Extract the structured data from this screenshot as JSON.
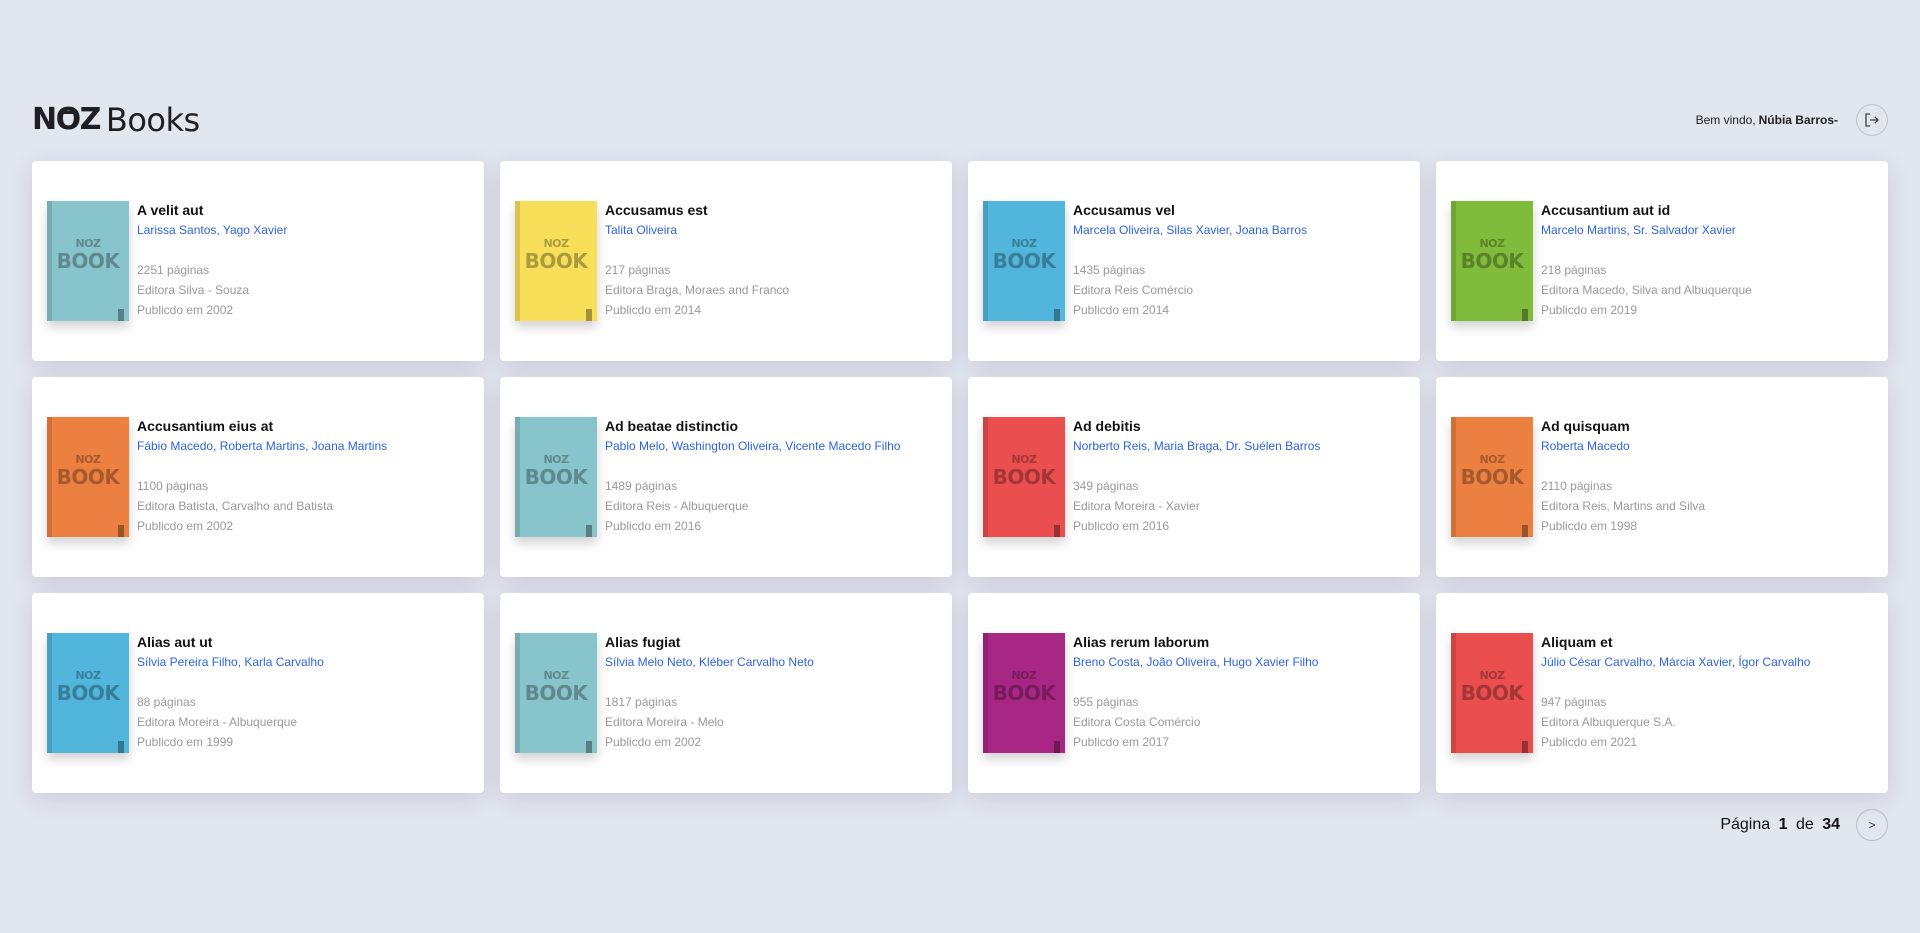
{
  "header": {
    "logo_mark": "NOZ",
    "logo_text": "Books",
    "greeting": "Bem vindo,",
    "user_name": "Núbia Barros-"
  },
  "books": [
    {
      "title": "A velit aut",
      "authors": "Larissa Santos, Yago Xavier",
      "pages": "2251 páginas",
      "publisher": "Editora Silva - Souza",
      "published": "Publicdo em 2002",
      "cover_color": "#88c4cb"
    },
    {
      "title": "Accusamus est",
      "authors": "Talita Oliveira",
      "pages": "217 páginas",
      "publisher": "Editora Braga, Moraes and Franco",
      "published": "Publicdo em 2014",
      "cover_color": "#f7df5a"
    },
    {
      "title": "Accusamus vel",
      "authors": "Marcela Oliveira, Silas Xavier, Joana Barros",
      "pages": "1435 páginas",
      "publisher": "Editora Reis Comércio",
      "published": "Publicdo em 2014",
      "cover_color": "#52b5dc"
    },
    {
      "title": "Accusantium aut id",
      "authors": "Marcelo Martins, Sr. Salvador Xavier",
      "pages": "218 páginas",
      "publisher": "Editora Macedo, Silva and Albuquerque",
      "published": "Publicdo em 2019",
      "cover_color": "#80bb3c"
    },
    {
      "title": "Accusantium eius at",
      "authors": "Fábio Macedo, Roberta Martins, Joana Martins",
      "pages": "1100 páginas",
      "publisher": "Editora Batista, Carvalho and Batista",
      "published": "Publicdo em 2002",
      "cover_color": "#ec8040"
    },
    {
      "title": "Ad beatae distinctio",
      "authors": "Pablo Melo, Washington Oliveira, Vicente Macedo Filho",
      "pages": "1489 páginas",
      "publisher": "Editora Reis - Albuquerque",
      "published": "Publicdo em 2016",
      "cover_color": "#88c4cb"
    },
    {
      "title": "Ad debitis",
      "authors": "Norberto Reis, Maria Braga, Dr. Suélen Barros",
      "pages": "349 páginas",
      "publisher": "Editora Moreira - Xavier",
      "published": "Publicdo em 2016",
      "cover_color": "#ea4e4e"
    },
    {
      "title": "Ad quisquam",
      "authors": "Roberta Macedo",
      "pages": "2110 páginas",
      "publisher": "Editora Reis, Martins and Silva",
      "published": "Publicdo em 1998",
      "cover_color": "#ec8040"
    },
    {
      "title": "Alias aut ut",
      "authors": "Sílvia Pereira Filho, Karla Carvalho",
      "pages": "88 páginas",
      "publisher": "Editora Moreira - Albuquerque",
      "published": "Publicdo em 1999",
      "cover_color": "#52b5dc"
    },
    {
      "title": "Alias fugiat",
      "authors": "Sílvia Melo Neto, Kléber Carvalho Neto",
      "pages": "1817 páginas",
      "publisher": "Editora Moreira - Melo",
      "published": "Publicdo em 2002",
      "cover_color": "#88c4cb"
    },
    {
      "title": "Alias rerum laborum",
      "authors": "Breno Costa, João Oliveira, Hugo Xavier Filho",
      "pages": "955 páginas",
      "publisher": "Editora Costa Comércio",
      "published": "Publicdo em 2017",
      "cover_color": "#a92784"
    },
    {
      "title": "Aliquam et",
      "authors": "Júlio César Carvalho, Márcia Xavier, Ígor Carvalho",
      "pages": "947 páginas",
      "publisher": "Editora Albuquerque S.A.",
      "published": "Publicdo em 2021",
      "cover_color": "#ea4e4e"
    }
  ],
  "cover_label": {
    "top": "NOZ",
    "bottom": "BOOK"
  },
  "pagination": {
    "prefix": "Página",
    "current": "1",
    "separator": "de",
    "total": "34",
    "next_label": ">"
  }
}
